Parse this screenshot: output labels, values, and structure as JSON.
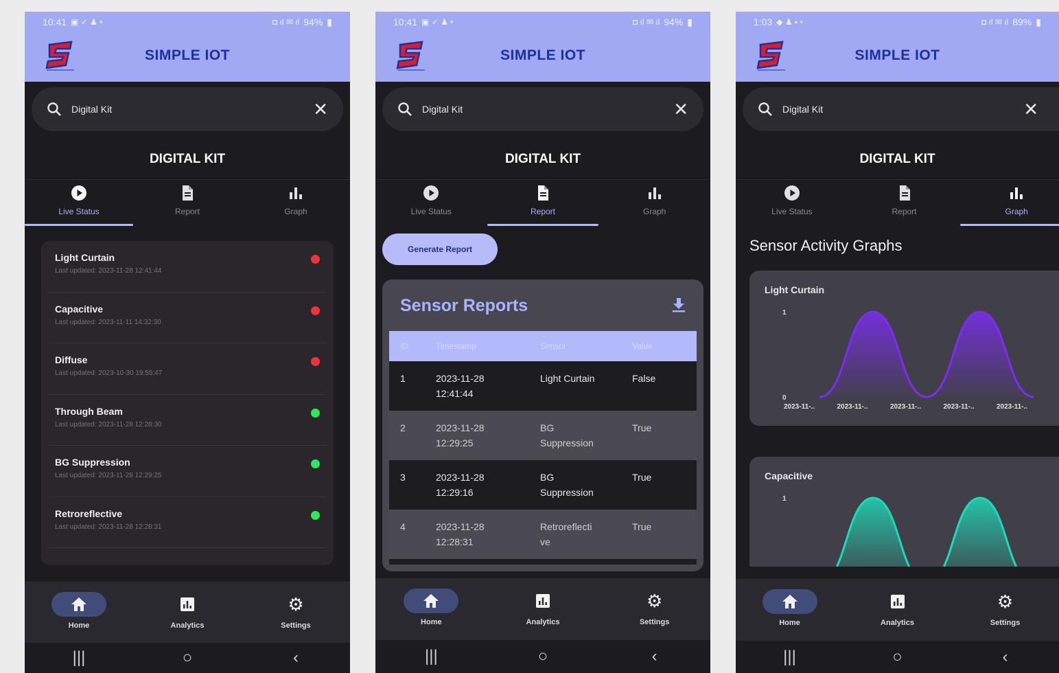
{
  "app": {
    "title": "SIMPLE IOT",
    "page_heading": "DIGITAL KIT",
    "accent_color": "#a2a9f3",
    "title_color": "#1f2ea3"
  },
  "search": {
    "value": "Digital Kit",
    "placeholder": ""
  },
  "tabs": [
    "Live Status",
    "Report",
    "Graph"
  ],
  "bottom_nav": [
    "Home",
    "Analytics",
    "Settings"
  ],
  "status_bars": [
    {
      "time": "10:41",
      "battery": "94%"
    },
    {
      "time": "10:41",
      "battery": "94%"
    },
    {
      "time": "1:03",
      "battery": "89%"
    }
  ],
  "live_status": {
    "sensors": [
      {
        "name": "Light Curtain",
        "updated": "Last updated: 2023-11-28 12:41:44",
        "status": "red"
      },
      {
        "name": "Capacitive",
        "updated": "Last updated: 2023-11-11 14:32:30",
        "status": "red"
      },
      {
        "name": "Diffuse",
        "updated": "Last updated: 2023-10-30 19:55:47",
        "status": "red"
      },
      {
        "name": "Through Beam",
        "updated": "Last updated: 2023-11-28 12:28:30",
        "status": "green"
      },
      {
        "name": "BG Suppression",
        "updated": "Last updated: 2023-11-28 12:29:25",
        "status": "green"
      },
      {
        "name": "Retroreflective",
        "updated": "Last updated: 2023-11-28 12:28:31",
        "status": "green"
      }
    ],
    "status_colors": {
      "red": "#f0323c",
      "green": "#2ee85c"
    }
  },
  "report": {
    "generate_label": "Generate Report",
    "title": "Sensor Reports",
    "headers": [
      "ID",
      "Timestamp",
      "Sensor",
      "Value"
    ],
    "rows": [
      {
        "id": "1",
        "date": "2023-11-28",
        "time": "12:41:44",
        "sensor_1": "Light Curtain",
        "sensor_2": "",
        "value": "False"
      },
      {
        "id": "2",
        "date": "2023-11-28",
        "time": "12:29:25",
        "sensor_1": "BG",
        "sensor_2": "Suppression",
        "value": "True"
      },
      {
        "id": "3",
        "date": "2023-11-28",
        "time": "12:29:16",
        "sensor_1": "BG",
        "sensor_2": "Suppression",
        "value": "True"
      },
      {
        "id": "4",
        "date": "2023-11-28",
        "time": "12:28:31",
        "sensor_1": "Retroreflecti",
        "sensor_2": "ve",
        "value": "True"
      }
    ]
  },
  "graph": {
    "title": "Sensor Activity Graphs",
    "charts": [
      {
        "name": "Light Curtain",
        "color": "#7b2df0"
      },
      {
        "name": "Capacitive",
        "color": "#1fd9b8"
      }
    ]
  },
  "chart_data": [
    {
      "type": "area",
      "title": "Light Curtain",
      "categories": [
        "2023-11-..",
        "2023-11-..",
        "2023-11-..",
        "2023-11-..",
        "2023-11-.."
      ],
      "series": [
        {
          "values": [
            0,
            1,
            0,
            1,
            0
          ]
        }
      ],
      "ytick_labels": [
        "0",
        "1"
      ],
      "ylim": [
        0,
        1
      ],
      "grid": false
    },
    {
      "type": "area",
      "title": "Capacitive",
      "categories": [],
      "series": [
        {
          "values": [
            0,
            1,
            0,
            1,
            0
          ]
        }
      ],
      "ytick_labels": [
        "1"
      ],
      "ylim": [
        0,
        1
      ],
      "grid": false
    }
  ]
}
